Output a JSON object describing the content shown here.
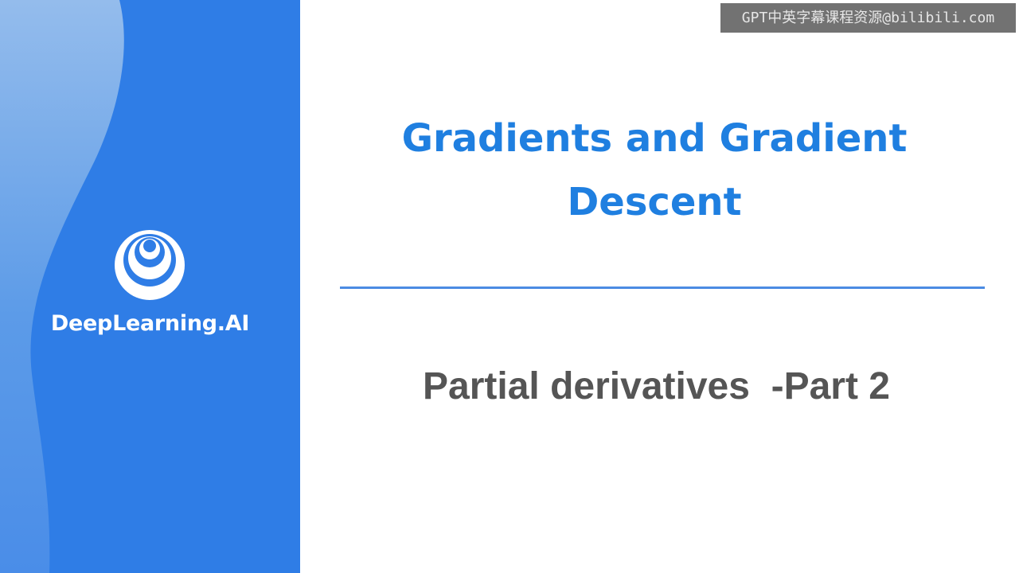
{
  "brand": {
    "name": "DeepLearning.AI",
    "sidebar_color": "#2f7de6",
    "logo_icon": "deeplearning-ai-logo-icon"
  },
  "slide": {
    "title": "Gradients and Gradient Descent",
    "subtitle": "Partial derivatives  -Part 2",
    "title_color": "#1f7fe0",
    "subtitle_color": "#555555"
  },
  "watermark": {
    "text": "GPT中英字幕课程资源@bilibili.com"
  }
}
